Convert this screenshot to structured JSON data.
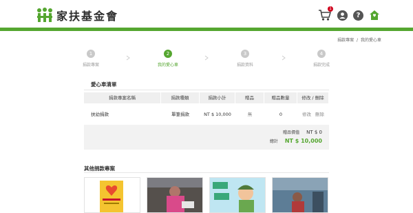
{
  "header": {
    "logo_text": "家扶基金會",
    "cart_badge": "1",
    "icons": [
      "cart-icon",
      "user-icon",
      "help-icon",
      "home-icon"
    ],
    "colors": {
      "brand_green": "#55a630",
      "dark": "#555555"
    }
  },
  "breadcrumb": {
    "items": [
      "捐款專案",
      "我的愛心車"
    ],
    "separator": "/"
  },
  "steps": [
    {
      "num": "1",
      "label": "捐款專案",
      "active": false
    },
    {
      "num": "2",
      "label": "我的愛心車",
      "active": true
    },
    {
      "num": "3",
      "label": "捐款資料",
      "active": false
    },
    {
      "num": "4",
      "label": "捐款完成",
      "active": false
    }
  ],
  "cart": {
    "title": "愛心車清單",
    "columns": [
      "捐款專案名稱",
      "捐款種類",
      "捐款小計",
      "贈品",
      "贈品數量",
      "修改 / 刪除"
    ],
    "rows": [
      {
        "name": "扶幼捐款",
        "type": "單筆捐款",
        "subtotal": "NT $ 10,000",
        "gift": "無",
        "gift_qty": "0",
        "edit": "修改",
        "delete": "刪除"
      }
    ],
    "gift_value_label": "贈品價值",
    "gift_value": "NT $ 0",
    "total_label": "總計",
    "total": "NT $ 10,000"
  },
  "other": {
    "title": "其他捐款專案"
  }
}
